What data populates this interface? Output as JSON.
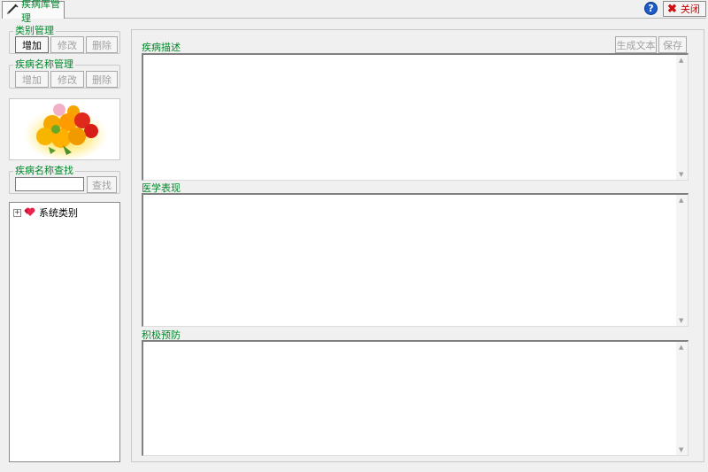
{
  "tab": {
    "label": "疾病库管理"
  },
  "window_buttons": {
    "help_label": "?",
    "close_label": "关闭"
  },
  "category_manage": {
    "title": "类别管理",
    "buttons": {
      "add": "增加",
      "edit": "修改",
      "delete": "删除"
    }
  },
  "name_manage": {
    "title": "疾病名称管理",
    "buttons": {
      "add": "增加",
      "edit": "修改",
      "delete": "删除"
    }
  },
  "search": {
    "title": "疾病名称查找",
    "input_value": "",
    "button": "查找"
  },
  "tree": {
    "root_label": "系统类别"
  },
  "right": {
    "description_label": "疾病描述",
    "generate_button": "生成文本",
    "save_button": "保存",
    "medical_label": "医学表现",
    "prevention_label": "积极预防"
  },
  "icons": {
    "tab": "syringe-icon",
    "help": "help-icon",
    "close": "close-icon",
    "tree_expand": "expand-plus-icon",
    "tree_node": "hearts-icon",
    "image": "fruit-image"
  },
  "colors": {
    "label_green": "#00882a",
    "close_red": "#d01010",
    "help_blue": "#1d5cc8"
  }
}
